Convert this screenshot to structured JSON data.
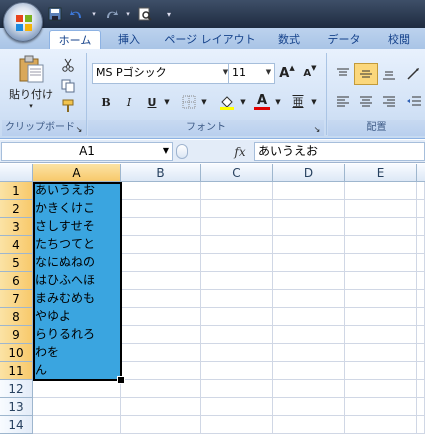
{
  "qat": {
    "save_icon": "save-icon",
    "undo_icon": "undo-icon",
    "redo_icon": "redo-icon",
    "preview_icon": "print-preview-icon",
    "customize_icon": "chevron-down-icon"
  },
  "tabs": [
    {
      "label": "ホーム",
      "active": true
    },
    {
      "label": "挿入"
    },
    {
      "label": "ページ レイアウト"
    },
    {
      "label": "数式"
    },
    {
      "label": "データ"
    },
    {
      "label": "校閲"
    }
  ],
  "ribbon": {
    "clipboard": {
      "paste_label": "貼り付け",
      "group_label": "クリップボード"
    },
    "font": {
      "font_name": "MS Pゴシック",
      "font_size": "11",
      "grow_label": "A",
      "shrink_label": "A",
      "bold": "B",
      "italic": "I",
      "underline": "U",
      "color_label": "A",
      "phonetic_label": "亜",
      "group_label": "フォント"
    },
    "alignment": {
      "group_label": "配置"
    }
  },
  "formula_bar": {
    "name_box": "A1",
    "fx_label": "fx",
    "content": "あいうえお"
  },
  "colors": {
    "selection": "#3aa5e0",
    "accent": "#15428b"
  },
  "sheet": {
    "columns": [
      "A",
      "B",
      "C",
      "D",
      "E"
    ],
    "rows": [
      "1",
      "2",
      "3",
      "4",
      "5",
      "6",
      "7",
      "8",
      "9",
      "10",
      "11",
      "12",
      "13",
      "14"
    ],
    "a_values": [
      "あいうえお",
      "かきくけこ",
      "さしすせそ",
      "たちつてと",
      "なにぬねの",
      "はひふへほ",
      "まみむめも",
      "やゆよ",
      "らりるれろ",
      "わを",
      "ん",
      "",
      ""
    ]
  }
}
